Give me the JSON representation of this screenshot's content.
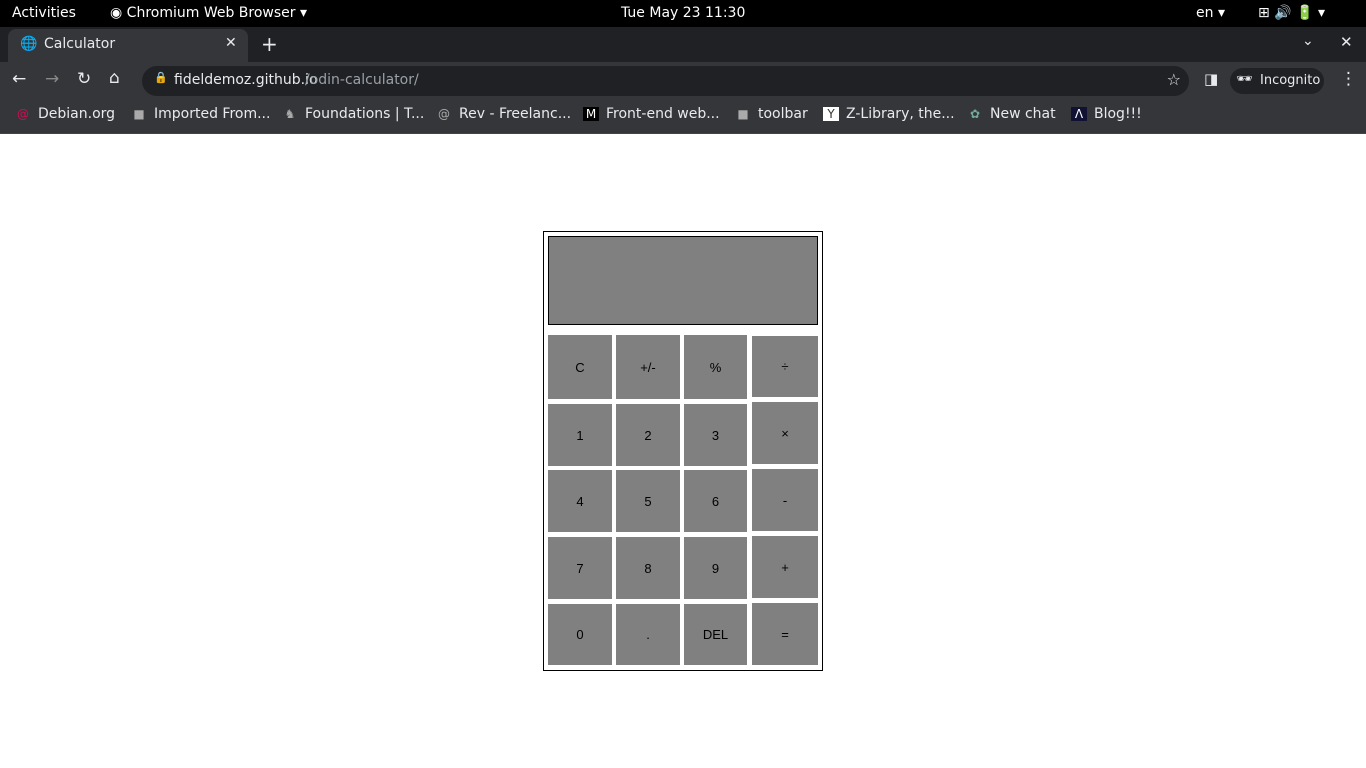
{
  "system": {
    "activities": "Activities",
    "app": "Chromium Web Browser",
    "clock": "Tue May 23  11:30",
    "lang": "en"
  },
  "browser": {
    "tab_title": "Calculator",
    "url_host": "fideldemoz.github.io",
    "url_path": "/odin-calculator/",
    "incognito": "Incognito"
  },
  "bookmarks": [
    "Debian.org",
    "Imported From...",
    "Foundations | T...",
    "Rev - Freelanc...",
    "Front-end web...",
    "toolbar",
    "Z-Library, the...",
    "New chat",
    "Blog!!!"
  ],
  "calculator": {
    "display": "",
    "keys": [
      [
        "C",
        "+/-",
        "%",
        "÷"
      ],
      [
        "1",
        "2",
        "3",
        "×"
      ],
      [
        "4",
        "5",
        "6",
        "-"
      ],
      [
        "7",
        "8",
        "9",
        "+"
      ],
      [
        "0",
        ".",
        "DEL",
        "="
      ]
    ]
  }
}
